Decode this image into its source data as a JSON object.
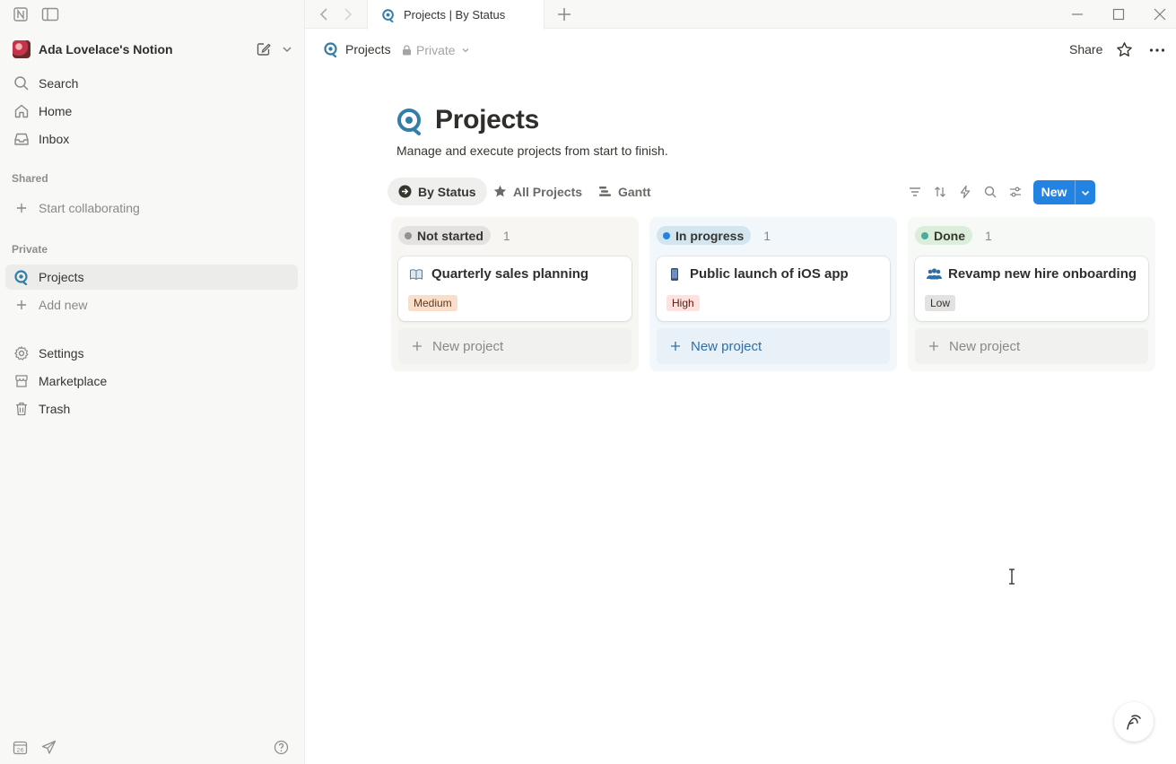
{
  "window": {
    "tab_title": "Projects | By Status"
  },
  "sidebar": {
    "workspace_name": "Ada Lovelace's Notion",
    "nav": [
      {
        "label": "Search",
        "icon": "search-icon"
      },
      {
        "label": "Home",
        "icon": "home-icon"
      },
      {
        "label": "Inbox",
        "icon": "inbox-icon"
      }
    ],
    "shared_section": "Shared",
    "shared_items": [
      {
        "label": "Start collaborating",
        "icon": "plus-icon"
      }
    ],
    "private_section": "Private",
    "private_items": [
      {
        "label": "Projects",
        "icon": "projects-icon"
      },
      {
        "label": "Add new",
        "icon": "plus-icon"
      }
    ],
    "bottom_items": [
      {
        "label": "Settings",
        "icon": "gear-icon"
      },
      {
        "label": "Marketplace",
        "icon": "marketplace-icon"
      },
      {
        "label": "Trash",
        "icon": "trash-icon"
      }
    ]
  },
  "topbar": {
    "breadcrumb": "Projects",
    "visibility": "Private",
    "share_label": "Share"
  },
  "page": {
    "title": "Projects",
    "description": "Manage and execute projects from start to finish.",
    "views": [
      {
        "label": "By Status",
        "icon": "arrow-circle-icon",
        "active": true
      },
      {
        "label": "All Projects",
        "icon": "star-icon",
        "active": false
      },
      {
        "label": "Gantt",
        "icon": "gantt-icon",
        "active": false
      }
    ],
    "new_button": "New"
  },
  "board": {
    "columns": [
      {
        "status": "Not started",
        "count": "1",
        "pill_bg": "#e3e2e0",
        "dot": "#91918e",
        "col_bg": "#f7f6f3",
        "card": {
          "title": "Quarterly sales planning",
          "icon": "book-icon",
          "tag": "Medium",
          "tag_bg": "#fadec9",
          "tag_fg": "#5c3b23"
        },
        "new_label": "New project",
        "new_color": "#8a8985"
      },
      {
        "status": "In progress",
        "count": "1",
        "pill_bg": "#d3e5ef",
        "dot": "#2383e2",
        "col_bg": "#f2f7fb",
        "card": {
          "title": "Public launch of iOS app",
          "icon": "phone-icon",
          "tag": "High",
          "tag_bg": "#ffe2dd",
          "tag_fg": "#5d1715"
        },
        "new_label": "New project",
        "new_color": "#2f6fa5"
      },
      {
        "status": "Done",
        "count": "1",
        "pill_bg": "#dbeddb",
        "dot": "#4dab9a",
        "col_bg": "#f6f9f6",
        "card": {
          "title": "Revamp new hire onboarding",
          "icon": "people-icon",
          "tag": "Low",
          "tag_bg": "#e3e2e0",
          "tag_fg": "#32302c"
        },
        "new_label": "New project",
        "new_color": "#8a8985"
      }
    ]
  },
  "colors": {
    "accent": "#2383e2",
    "sidebar_bg": "#f8f8f7",
    "text": "#37352f"
  }
}
